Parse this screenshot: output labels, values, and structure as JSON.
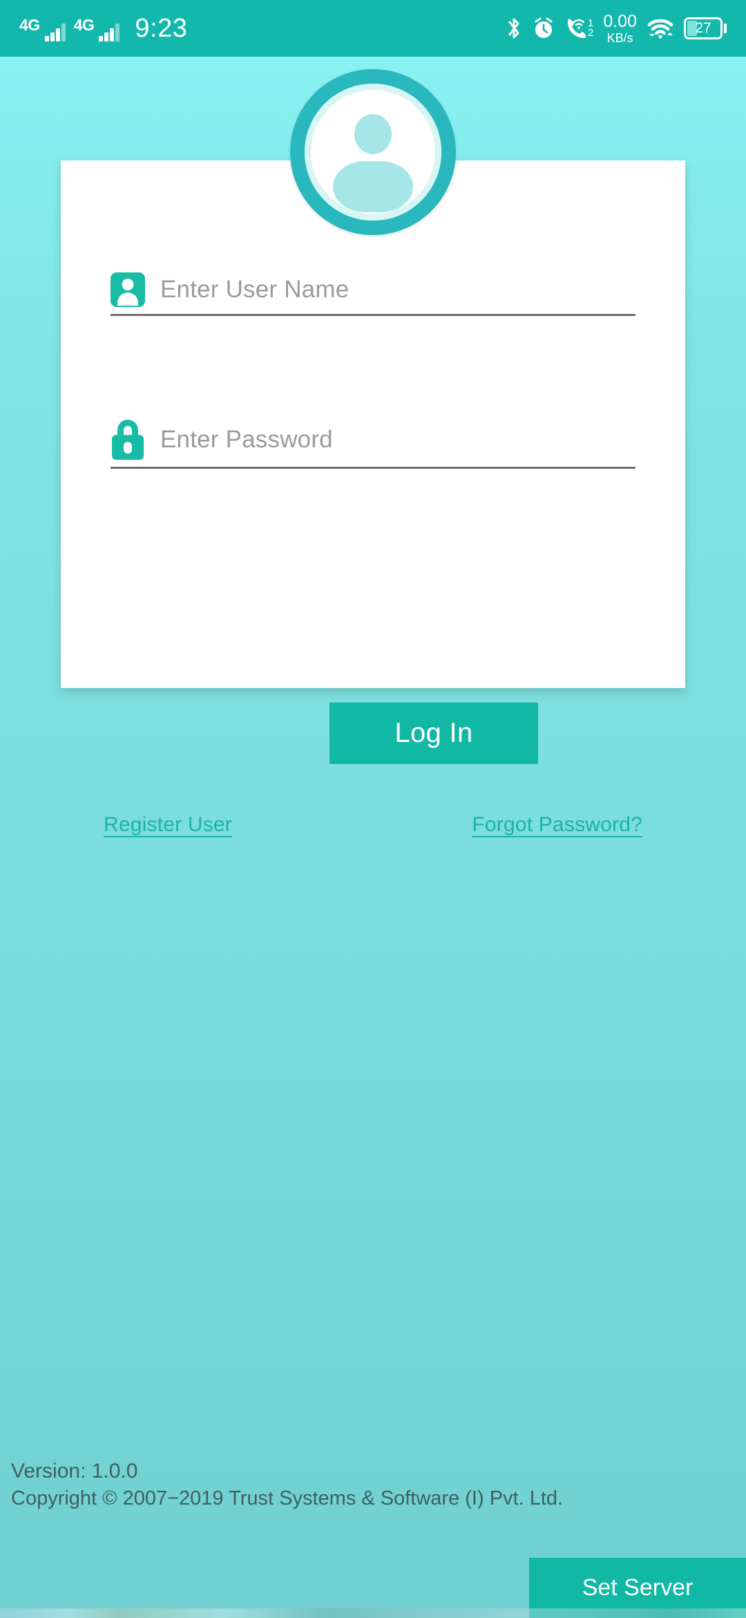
{
  "statusbar": {
    "sim1": {
      "network_label": "4G",
      "icon": "signal-bars-icon"
    },
    "sim2": {
      "network_label": "4G",
      "icon": "signal-bars-icon"
    },
    "time": "9:23",
    "bluetooth_icon": "bluetooth-icon",
    "alarm_icon": "alarm-clock-icon",
    "volte_icon": "vowifi-call-icon",
    "volte_sim_labels": {
      "top": "1",
      "bottom": "2"
    },
    "network_speed": {
      "value": "0.00",
      "unit": "KB/s"
    },
    "wifi_icon": "wifi-icon",
    "data_transfer_icon": "data-transfer-icon",
    "battery": {
      "level": "27",
      "icon": "battery-icon"
    }
  },
  "avatar": {
    "icon": "user-avatar-icon",
    "ring_color": "#29b8bd",
    "silhouette_color": "#a6e6e6"
  },
  "login": {
    "username": {
      "icon": "contact-card-icon",
      "placeholder": "Enter User Name",
      "value": ""
    },
    "password": {
      "icon": "lock-icon",
      "placeholder": "Enter Password",
      "value": ""
    },
    "login_button": "Log In",
    "register_link": "Register User",
    "forgot_link": "Forgot Password?"
  },
  "footer": {
    "version": "Version: 1.0.0",
    "copyright": "Copyright © 2007−2019 Trust Systems & Software (I) Pvt. Ltd.",
    "set_server_button": "Set Server"
  },
  "colors": {
    "status_bar": "#12b8ab",
    "accent_teal": "#11b8a4",
    "link_teal": "#1ab4a6",
    "bg_top": "#8df4f4",
    "bg_bottom": "#70cfcf",
    "card": "#ffffff"
  }
}
